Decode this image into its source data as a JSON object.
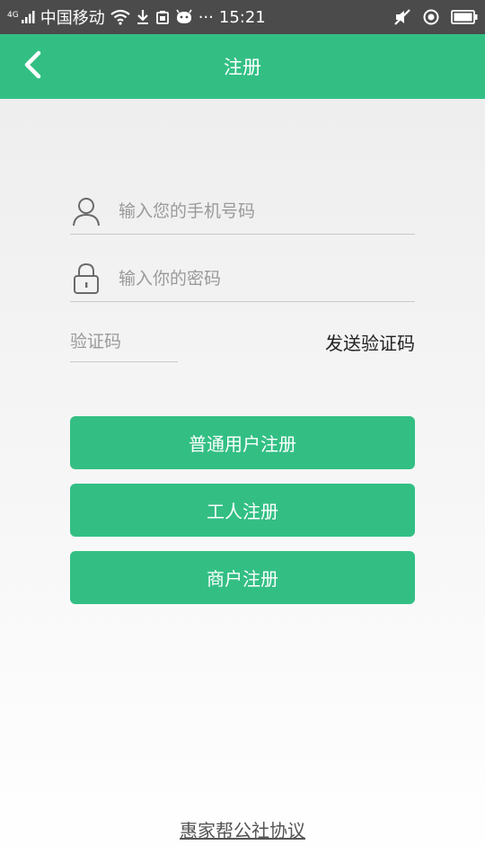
{
  "status_bar": {
    "network": "4G",
    "carrier": "中国移动",
    "more": "···",
    "time": "15:21",
    "icons": [
      "signal-icon",
      "wifi-icon",
      "download-icon",
      "sim-icon",
      "android-icon",
      "mute-icon",
      "location-icon",
      "battery-icon"
    ]
  },
  "header": {
    "title": "注册",
    "back_icon": "chevron-left-icon"
  },
  "form": {
    "phone": {
      "placeholder": "输入您的手机号码",
      "icon": "user-icon"
    },
    "password": {
      "placeholder": "输入你的密码",
      "icon": "lock-icon"
    },
    "code": {
      "placeholder": "验证码",
      "send_label": "发送验证码"
    }
  },
  "buttons": {
    "normal_user": "普通用户注册",
    "worker": "工人注册",
    "merchant": "商户注册"
  },
  "footer": {
    "agreement": "惠家帮公社协议"
  },
  "colors": {
    "accent": "#33bf84",
    "status_bar": "#4b4b4b"
  }
}
